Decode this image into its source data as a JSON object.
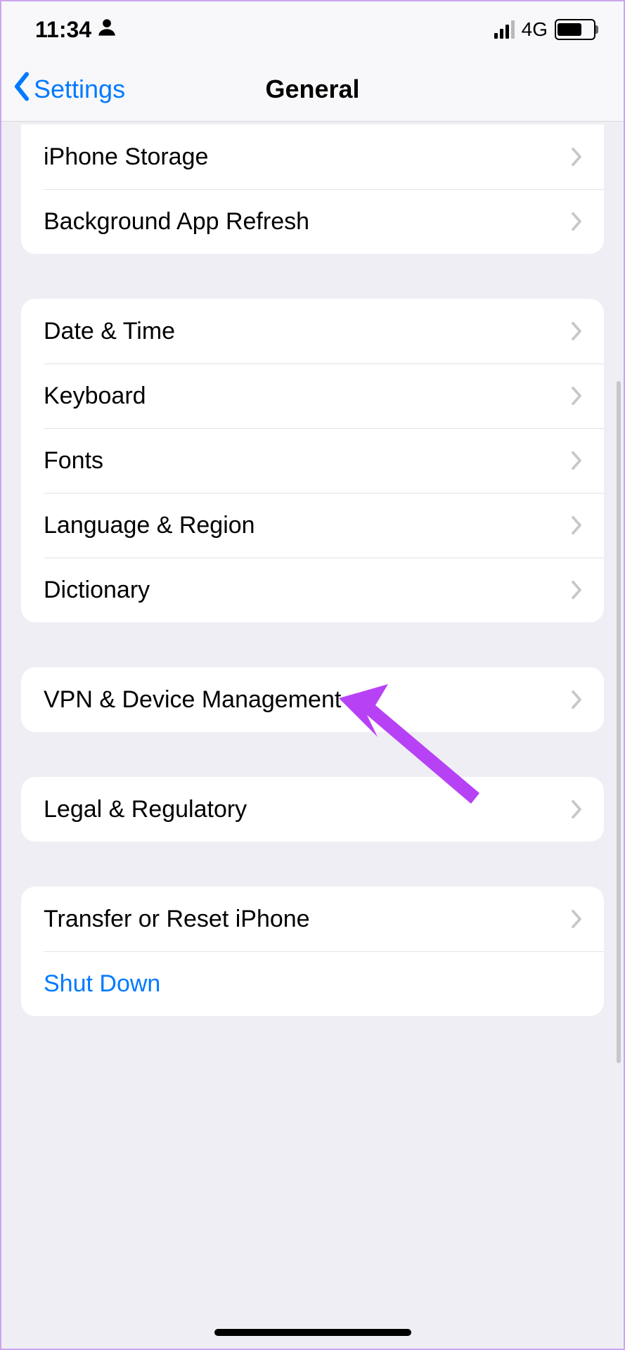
{
  "statusBar": {
    "time": "11:34",
    "network": "4G",
    "batteryPct": 70
  },
  "nav": {
    "back": "Settings",
    "title": "General"
  },
  "groups": [
    {
      "id": "storage",
      "items": [
        {
          "id": "iphone-storage",
          "label": "iPhone Storage",
          "chevron": true
        },
        {
          "id": "background-app-refresh",
          "label": "Background App Refresh",
          "chevron": true
        }
      ]
    },
    {
      "id": "locale",
      "items": [
        {
          "id": "date-time",
          "label": "Date & Time",
          "chevron": true
        },
        {
          "id": "keyboard",
          "label": "Keyboard",
          "chevron": true
        },
        {
          "id": "fonts",
          "label": "Fonts",
          "chevron": true
        },
        {
          "id": "language-region",
          "label": "Language & Region",
          "chevron": true
        },
        {
          "id": "dictionary",
          "label": "Dictionary",
          "chevron": true
        }
      ]
    },
    {
      "id": "vpn",
      "items": [
        {
          "id": "vpn-device-management",
          "label": "VPN & Device Management",
          "chevron": true
        }
      ]
    },
    {
      "id": "legal",
      "items": [
        {
          "id": "legal-regulatory",
          "label": "Legal & Regulatory",
          "chevron": true
        }
      ]
    },
    {
      "id": "reset",
      "items": [
        {
          "id": "transfer-reset",
          "label": "Transfer or Reset iPhone",
          "chevron": true
        },
        {
          "id": "shut-down",
          "label": "Shut Down",
          "chevron": false,
          "action": true
        }
      ]
    }
  ],
  "annotation": {
    "targetRowId": "vpn-device-management",
    "color": "#b742f5"
  }
}
